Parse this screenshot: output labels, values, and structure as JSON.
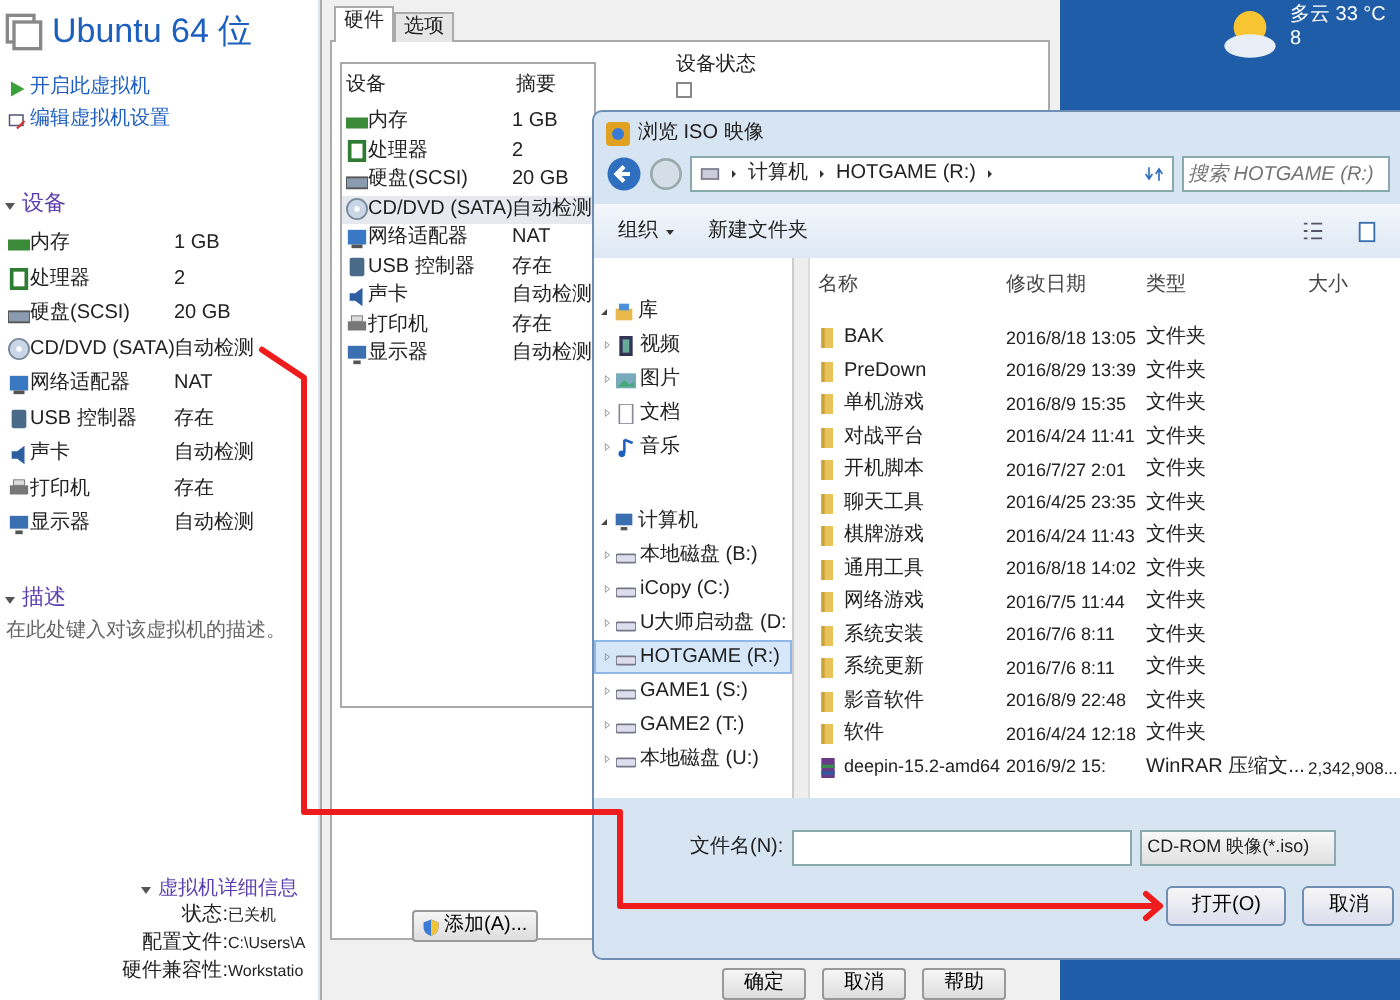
{
  "vm_panel": {
    "title": "Ubuntu 64 位",
    "actions": [
      {
        "kind": "power",
        "label": "开启此虚拟机"
      },
      {
        "kind": "edit",
        "label": "编辑虚拟机设置"
      }
    ],
    "devices_heading": "设备",
    "devices": [
      {
        "kind": "memory",
        "name": "内存",
        "summary": "1 GB"
      },
      {
        "kind": "cpu",
        "name": "处理器",
        "summary": "2"
      },
      {
        "kind": "disk",
        "name": "硬盘(SCSI)",
        "summary": "20 GB"
      },
      {
        "kind": "cdrom",
        "name": "CD/DVD (SATA)",
        "summary": "自动检测"
      },
      {
        "kind": "network",
        "name": "网络适配器",
        "summary": "NAT"
      },
      {
        "kind": "usb",
        "name": "USB 控制器",
        "summary": "存在"
      },
      {
        "kind": "sound",
        "name": "声卡",
        "summary": "自动检测"
      },
      {
        "kind": "printer",
        "name": "打印机",
        "summary": "存在"
      },
      {
        "kind": "display",
        "name": "显示器",
        "summary": "自动检测"
      }
    ],
    "description_heading": "描述",
    "description_placeholder": "在此处键入对该虚拟机的描述。",
    "details_heading": "虚拟机详细信息",
    "details": [
      {
        "label": "状态:",
        "value": "已关机"
      },
      {
        "label": "配置文件:",
        "value": "C:\\Users\\A"
      },
      {
        "label": "硬件兼容性:",
        "value": "Workstatio"
      }
    ]
  },
  "settings_dialog": {
    "tabs": [
      {
        "label": "硬件",
        "selected": true
      },
      {
        "label": "选项",
        "selected": false
      }
    ],
    "columns": [
      "设备",
      "摘要"
    ],
    "devices": [
      {
        "kind": "memory",
        "name": "内存",
        "summary": "1 GB",
        "selected": false
      },
      {
        "kind": "cpu",
        "name": "处理器",
        "summary": "2",
        "selected": false
      },
      {
        "kind": "disk",
        "name": "硬盘(SCSI)",
        "summary": "20 GB",
        "selected": false
      },
      {
        "kind": "cdrom",
        "name": "CD/DVD (SATA)",
        "summary": "自动检测",
        "selected": true
      },
      {
        "kind": "network",
        "name": "网络适配器",
        "summary": "NAT",
        "selected": false
      },
      {
        "kind": "usb",
        "name": "USB 控制器",
        "summary": "存在",
        "selected": false
      },
      {
        "kind": "sound",
        "name": "声卡",
        "summary": "自动检测",
        "selected": false
      },
      {
        "kind": "printer",
        "name": "打印机",
        "summary": "存在",
        "selected": false
      },
      {
        "kind": "display",
        "name": "显示器",
        "summary": "自动检测",
        "selected": false
      }
    ],
    "status_heading": "设备状态",
    "status_checkbox": {
      "checked": false
    },
    "add_button": "添加(A)...",
    "buttons": [
      "确定",
      "取消",
      "帮助"
    ]
  },
  "weather": {
    "condition": "多云 33 °C",
    "line_2": "8"
  },
  "file_dialog": {
    "title": "浏览 ISO 映像",
    "breadcrumb": [
      "计算机",
      "HOTGAME (R:)"
    ],
    "search_placeholder": "搜索 HOTGAME (R:)",
    "toolbar": [
      "组织",
      "新建文件夹"
    ],
    "nav": [
      {
        "kind": "library",
        "label": "库",
        "expanded": true,
        "children": [
          {
            "kind": "video",
            "label": "视频",
            "selected": false
          },
          {
            "kind": "picture",
            "label": "图片",
            "selected": false
          },
          {
            "kind": "document",
            "label": "文档",
            "selected": false
          },
          {
            "kind": "music",
            "label": "音乐",
            "selected": false
          }
        ]
      },
      {
        "kind": "computer",
        "label": "计算机",
        "expanded": true,
        "children": [
          {
            "kind": "drive",
            "label": "本地磁盘 (B:)",
            "selected": false
          },
          {
            "kind": "drive",
            "label": "iCopy (C:)",
            "selected": false
          },
          {
            "kind": "drive",
            "label": "U大师启动盘 (D:",
            "selected": false
          },
          {
            "kind": "drive",
            "label": "HOTGAME (R:)",
            "selected": true
          },
          {
            "kind": "drive",
            "label": "GAME1 (S:)",
            "selected": false
          },
          {
            "kind": "drive",
            "label": "GAME2 (T:)",
            "selected": false
          },
          {
            "kind": "drive",
            "label": "本地磁盘 (U:)",
            "selected": false
          }
        ]
      }
    ],
    "columns": [
      "名称",
      "修改日期",
      "类型",
      "大小"
    ],
    "files": [
      {
        "kind": "folder",
        "name": "BAK",
        "date": "2016/8/18 13:05",
        "type": "文件夹"
      },
      {
        "kind": "folder",
        "name": "PreDown",
        "date": "2016/8/29 13:39",
        "type": "文件夹"
      },
      {
        "kind": "folder",
        "name": "单机游戏",
        "date": "2016/8/9 15:35",
        "type": "文件夹"
      },
      {
        "kind": "folder",
        "name": "对战平台",
        "date": "2016/4/24 11:41",
        "type": "文件夹"
      },
      {
        "kind": "folder",
        "name": "开机脚本",
        "date": "2016/7/27 2:01",
        "type": "文件夹"
      },
      {
        "kind": "folder",
        "name": "聊天工具",
        "date": "2016/4/25 23:35",
        "type": "文件夹"
      },
      {
        "kind": "folder",
        "name": "棋牌游戏",
        "date": "2016/4/24 11:43",
        "type": "文件夹"
      },
      {
        "kind": "folder",
        "name": "通用工具",
        "date": "2016/8/18 14:02",
        "type": "文件夹"
      },
      {
        "kind": "folder",
        "name": "网络游戏",
        "date": "2016/7/5 11:44",
        "type": "文件夹"
      },
      {
        "kind": "folder",
        "name": "系统安装",
        "date": "2016/7/6 8:11",
        "type": "文件夹"
      },
      {
        "kind": "folder",
        "name": "系统更新",
        "date": "2016/7/6 8:11",
        "type": "文件夹"
      },
      {
        "kind": "folder",
        "name": "影音软件",
        "date": "2016/8/9 22:48",
        "type": "文件夹"
      },
      {
        "kind": "folder",
        "name": "软件",
        "date": "2016/4/24 12:18",
        "type": "文件夹"
      },
      {
        "kind": "archive",
        "name": "deepin-15.2-amd64",
        "date": "2016/9/2 15:",
        "type": "WinRAR 压缩文...",
        "size": "2,342,908..."
      }
    ],
    "filename_label": "文件名(N):",
    "filter": "CD-ROM 映像(*.iso)",
    "buttons": [
      "打开(O)",
      "取消"
    ]
  }
}
